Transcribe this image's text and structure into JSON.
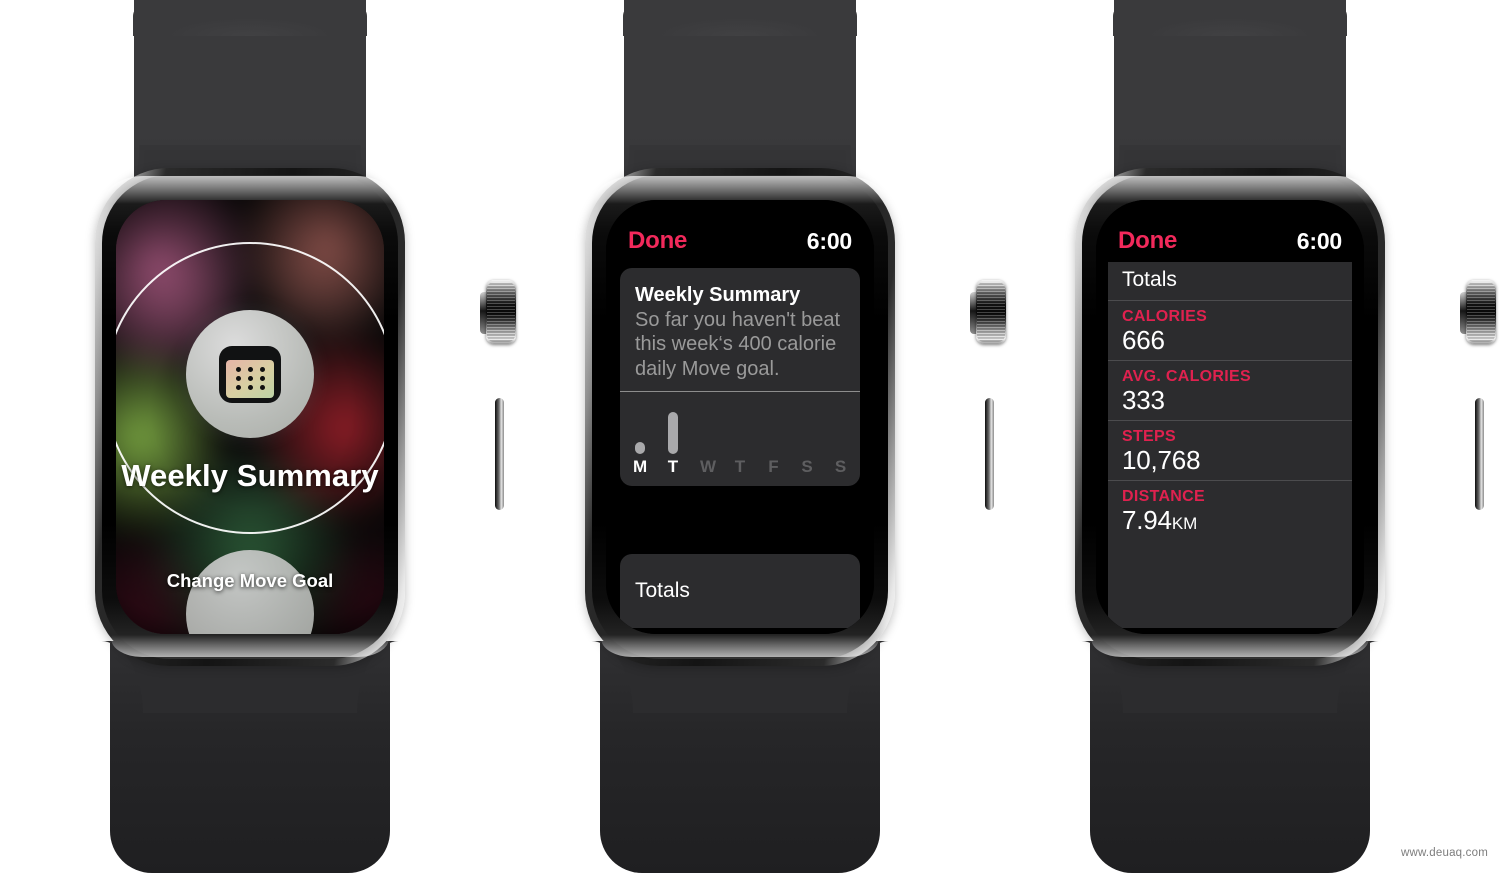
{
  "watermark": "www.deuaq.com",
  "watch1": {
    "app_icon": "calendar-icon",
    "title": "Weekly Summary",
    "next_item_label": "Change Move Goal"
  },
  "watch2": {
    "status": {
      "back_label": "Done",
      "time": "6:00"
    },
    "card": {
      "title": "Weekly Summary",
      "body": "So far you haven't beat this week‘s 400 calorie daily Move goal."
    },
    "totals_label": "Totals",
    "chart_data": {
      "type": "bar",
      "title": "Weekly Summary",
      "categories": [
        "M",
        "T",
        "W",
        "T",
        "F",
        "S",
        "S"
      ],
      "values": [
        12,
        42,
        0,
        0,
        0,
        0,
        0
      ],
      "active": [
        true,
        true,
        false,
        false,
        false,
        false,
        false
      ],
      "xlabel": "",
      "ylabel": "",
      "ylim": [
        0,
        52
      ],
      "grid": false,
      "legend": "none",
      "bar_color": "#a9a9ab",
      "label_color_active": "#ffffff",
      "label_color_inactive": "#5e5e60"
    }
  },
  "watch3": {
    "status": {
      "back_label": "Done",
      "time": "6:00"
    },
    "panel_title": "Totals",
    "metrics": [
      {
        "label": "CALORIES",
        "value": "666",
        "unit": ""
      },
      {
        "label": "AVG. CALORIES",
        "value": "333",
        "unit": ""
      },
      {
        "label": "STEPS",
        "value": "10,768",
        "unit": ""
      },
      {
        "label": "DISTANCE",
        "value": "7.94",
        "unit": "KM"
      }
    ]
  },
  "colors": {
    "accent_red": "#f2295b",
    "metric_label": "#e0214f",
    "card_bg": "#2c2c2e",
    "screen_bg": "#000000",
    "band": "#3a3a3c"
  }
}
